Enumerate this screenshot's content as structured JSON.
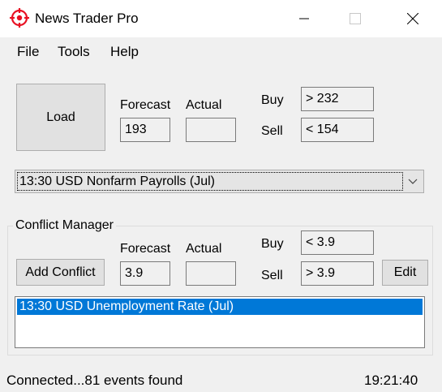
{
  "window": {
    "title": "News Trader Pro",
    "icons": [
      "crosshair-icon",
      "minimize-icon",
      "maximize-icon",
      "close-icon"
    ]
  },
  "menu": [
    "File",
    "Tools",
    "Help"
  ],
  "main": {
    "load_label": "Load",
    "forecast_label": "Forecast",
    "actual_label": "Actual",
    "buy_label": "Buy",
    "sell_label": "Sell",
    "forecast_value": "193",
    "actual_value": "",
    "buy_value": "> 232",
    "sell_value": "< 154",
    "selected_event": "13:30 USD Nonfarm Payrolls (Jul)"
  },
  "conflict": {
    "title": "Conflict Manager",
    "add_label": "Add Conflict",
    "forecast_label": "Forecast",
    "actual_label": "Actual",
    "buy_label": "Buy",
    "sell_label": "Sell",
    "forecast_value": "3.9",
    "actual_value": "",
    "buy_value": "< 3.9",
    "sell_value": "> 3.9",
    "edit_label": "Edit",
    "items": [
      "13:30 USD Unemployment Rate (Jul)"
    ]
  },
  "status": {
    "message": "Connected...81 events found",
    "time": "19:21:40"
  },
  "colors": {
    "accent": "#e81123",
    "selection": "#0078d7"
  }
}
